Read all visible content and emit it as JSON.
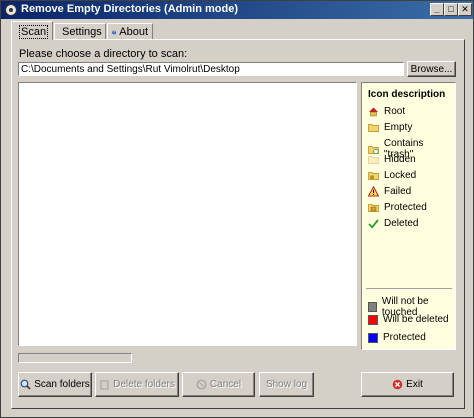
{
  "window": {
    "title": "Remove Empty Directories (Admin mode)",
    "controls": {
      "minimize": "_",
      "maximize": "□",
      "close": "✕"
    }
  },
  "tabs": [
    {
      "label": "Scan",
      "icon": "magnifier-icon",
      "active": true
    },
    {
      "label": "Settings",
      "icon": "tools-icon",
      "active": false
    },
    {
      "label": "About",
      "icon": "help-icon",
      "active": false
    }
  ],
  "scan": {
    "choose_label": "Please choose a directory to scan:",
    "path_value": "C:\\Documents and Settings\\Rut Vimolrut\\Desktop",
    "browse_label": "Browse...",
    "progress_percent": 0
  },
  "legend": {
    "title": "Icon description",
    "items": [
      {
        "label": "Root",
        "icon": "root-icon"
      },
      {
        "label": "Empty",
        "icon": "empty-folder-icon"
      },
      {
        "label": "Contains \"trash\"",
        "icon": "trash-folder-icon"
      },
      {
        "label": "Hidden",
        "icon": "hidden-folder-icon"
      },
      {
        "label": "Locked",
        "icon": "locked-folder-icon"
      },
      {
        "label": "Failed",
        "icon": "failed-icon"
      },
      {
        "label": "Protected",
        "icon": "protected-folder-icon"
      },
      {
        "label": "Deleted",
        "icon": "checkmark-icon"
      }
    ],
    "colors": [
      {
        "label": "Will not be touched",
        "color": "#808080"
      },
      {
        "label": "Will be deleted",
        "color": "#ff0000"
      },
      {
        "label": "Protected",
        "color": "#0000ff"
      }
    ]
  },
  "buttons": {
    "scan": "Scan folders",
    "delete": "Delete folders",
    "cancel": "Cancel",
    "show_log": "Show log",
    "exit": "Exit"
  }
}
